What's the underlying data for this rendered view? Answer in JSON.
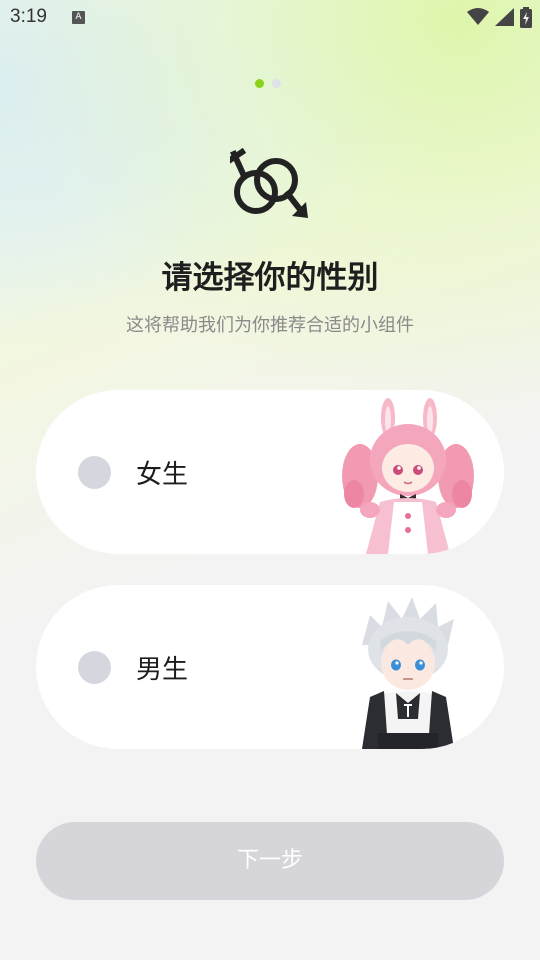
{
  "status_bar": {
    "time": "3:19",
    "notification_icon": "A",
    "icons": [
      "wifi-icon",
      "signal-icon",
      "battery-icon"
    ]
  },
  "pager": {
    "total": 2,
    "current": 1
  },
  "header": {
    "icon": "gender-symbol-icon",
    "title": "请选择你的性别",
    "subtitle": "这将帮助我们为你推荐合适的小组件"
  },
  "options": [
    {
      "label": "女生",
      "selected": false,
      "image": "anime-girl-pink-bunny-ears"
    },
    {
      "label": "男生",
      "selected": false,
      "image": "anime-boy-silver-hair"
    }
  ],
  "next_button": {
    "label": "下一步",
    "enabled": false
  },
  "colors": {
    "accent": "#8ad31a",
    "radio": "#d4d7dd",
    "button_disabled": "#d5d5da"
  }
}
